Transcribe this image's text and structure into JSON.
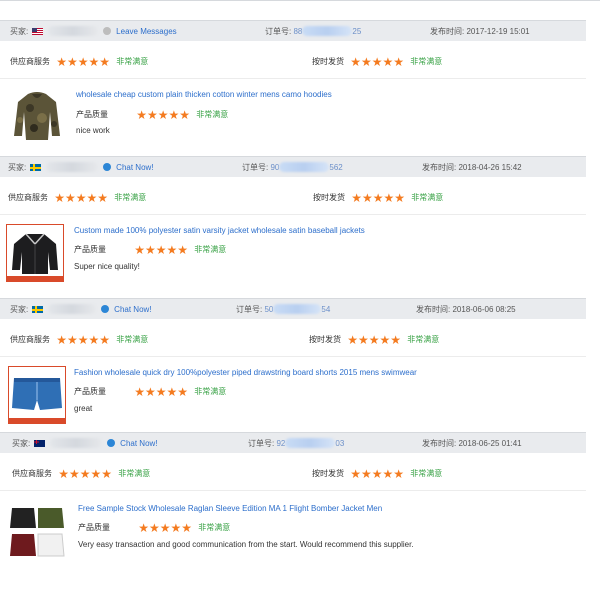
{
  "labels": {
    "buyer": "买家:",
    "order": "订单号:",
    "published": "发布时间:",
    "supplier_service": "供应商服务",
    "shipping": "按时发货",
    "product_quality": "产品质量",
    "very_satisfied": "非常满意",
    "stars": "★★★★★"
  },
  "reviews": [
    {
      "buyer_flag": "us-flag",
      "status_icon": "gray-dot-icon",
      "contact_label": "Leave Messages",
      "order_start": "88",
      "order_end": "25",
      "published": "2017-12-19 15:01",
      "product_title": "wholesale cheap custom plain thicken cotton winter mens camo hoodies",
      "comment": "nice work",
      "thumbnail": "camo-hoodie"
    },
    {
      "buyer_flag": "se-flag",
      "status_icon": "chat-bubble-icon",
      "contact_label": "Chat Now!",
      "order_start": "90",
      "order_end": "562",
      "published": "2018-04-26 15:42",
      "product_title": "Custom made 100% polyester satin varsity jacket wholesale satin baseball jackets",
      "comment": "Super nice quality!",
      "thumbnail": "satin-jacket"
    },
    {
      "buyer_flag": "se-flag",
      "status_icon": "chat-bubble-icon",
      "contact_label": "Chat Now!",
      "order_start": "50",
      "order_end": "54",
      "published": "2018-06-06 08:25",
      "product_title": "Fashion wholesale quick dry 100%polyester piped drawstring board shorts 2015 mens swimwear",
      "comment": "great",
      "thumbnail": "board-shorts"
    },
    {
      "buyer_flag": "au-flag",
      "status_icon": "chat-bubble-icon",
      "contact_label": "Chat Now!",
      "order_start": "92",
      "order_end": "03",
      "published": "2018-06-25 01:41",
      "product_title": "Free Sample Stock Wholesale Raglan Sleeve Edition MA 1 Flight Bomber Jacket Men",
      "comment": "Very easy transaction and good communication from the start. Would recommend this supplier.",
      "thumbnail": "bomber-jackets"
    }
  ],
  "colors": {
    "star": "#f47b20",
    "satisfied": "#37a144",
    "link": "#2c6ecb",
    "header_bg": "#e9ebee"
  }
}
